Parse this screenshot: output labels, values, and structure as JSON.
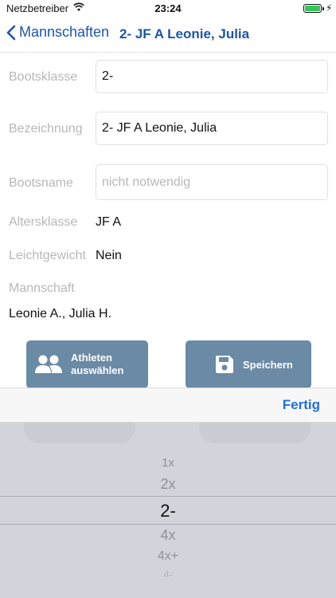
{
  "status_bar": {
    "carrier": "Netzbetreiber",
    "time": "23:24",
    "battery_color": "#34c759"
  },
  "nav": {
    "back_label": "Mannschaften",
    "title": "2- JF A Leonie, Julia"
  },
  "form": {
    "bootsklasse": {
      "label": "Bootsklasse",
      "value": "2-"
    },
    "bezeichnung": {
      "label": "Bezeichnung",
      "value": "2- JF A Leonie, Julia"
    },
    "bootsname": {
      "label": "Bootsname",
      "placeholder": "nicht notwendig"
    },
    "altersklasse": {
      "label": "Altersklasse",
      "value": "JF A"
    },
    "leichtgewicht": {
      "label": "Leichtgewicht",
      "value": "Nein"
    },
    "mannschaft": {
      "label": "Mannschaft",
      "value": "Leonie A., Julia H."
    }
  },
  "actions": {
    "athletes_line1": "Athleten",
    "athletes_line2": "auswählen",
    "save": "Speichern",
    "color": "#6a8aa5"
  },
  "picker": {
    "done_label": "Fertig",
    "options": [
      "1x",
      "2x",
      "2-",
      "4x",
      "4x+",
      "4-"
    ],
    "selected": "2-"
  }
}
